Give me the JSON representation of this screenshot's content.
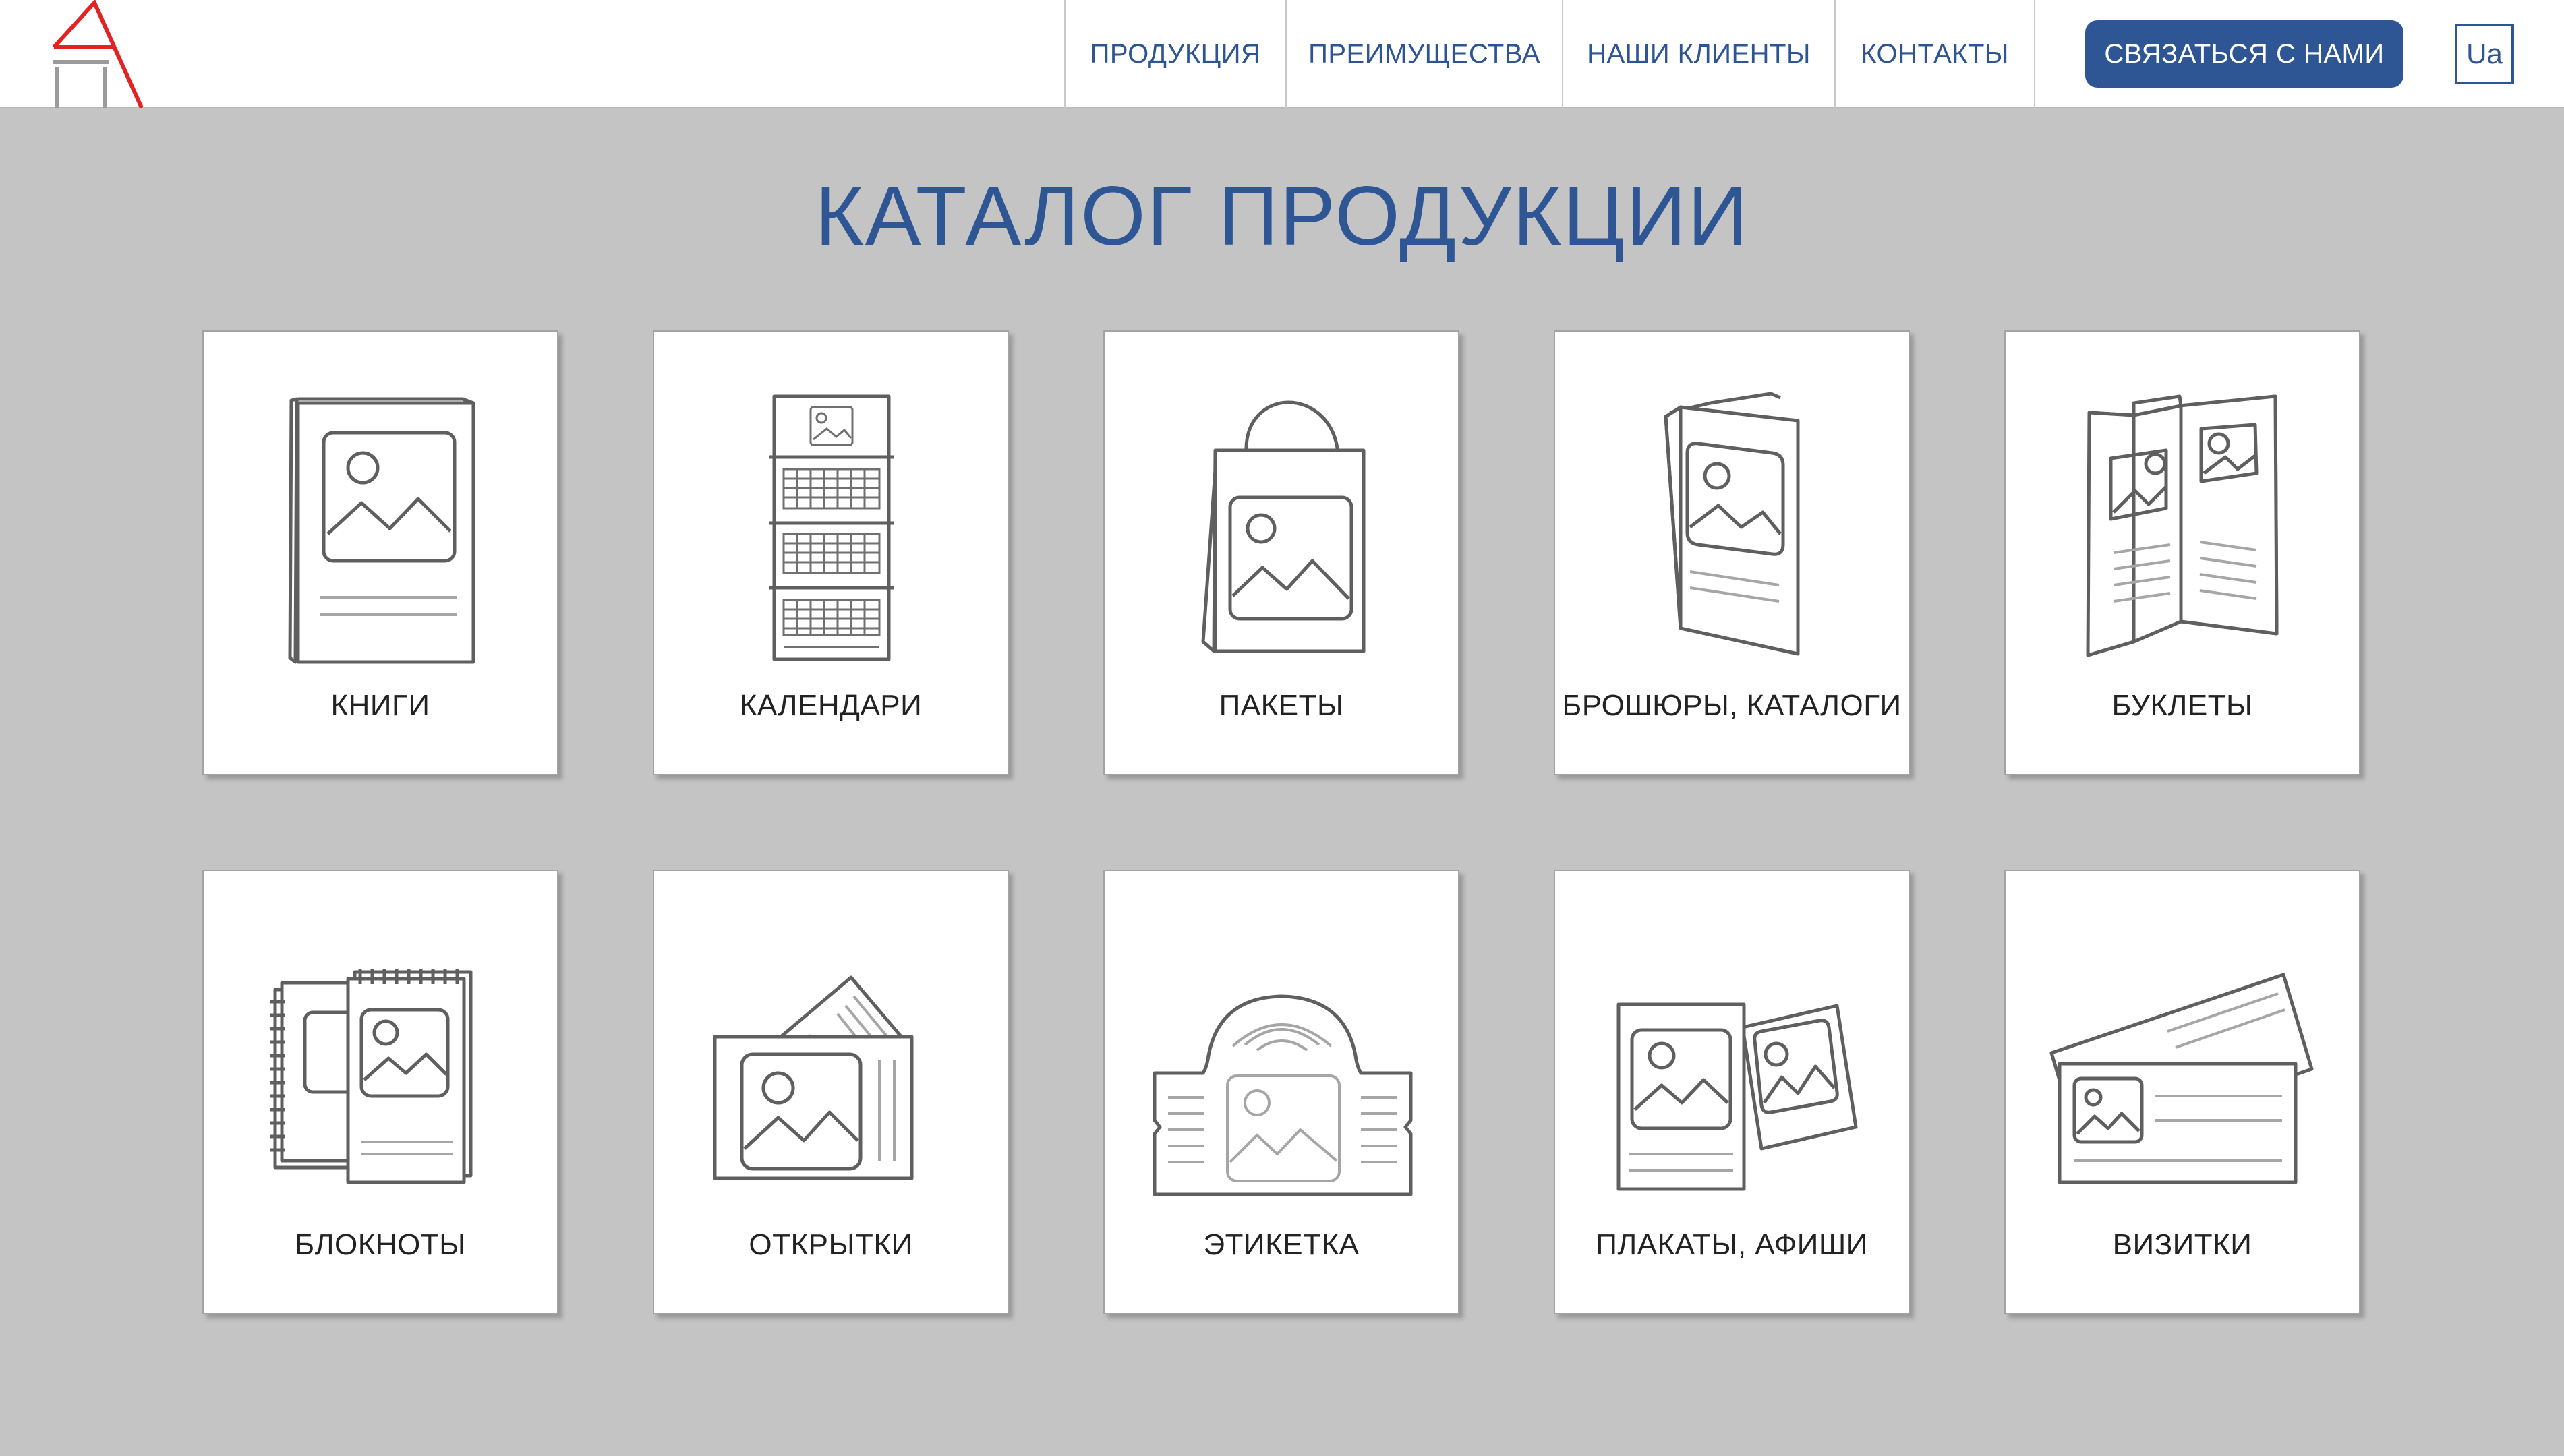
{
  "header": {
    "nav": [
      {
        "label": "ПРОДУКЦИЯ"
      },
      {
        "label": "ПРЕИМУЩЕСТВА"
      },
      {
        "label": "НАШИ КЛИЕНТЫ"
      },
      {
        "label": "КОНТАКТЫ"
      }
    ],
    "cta_label": "СВЯЗАТЬСЯ С НАМИ",
    "lang_label": "Ua"
  },
  "main": {
    "title": "КАТАЛОГ ПРОДУКЦИИ",
    "products": [
      {
        "label": "КНИГИ",
        "icon": "book-icon"
      },
      {
        "label": "КАЛЕНДАРИ",
        "icon": "calendar-icon"
      },
      {
        "label": "ПАКЕТЫ",
        "icon": "shopping-bag-icon"
      },
      {
        "label": "БРОШЮРЫ, КАТАЛОГИ",
        "icon": "brochure-icon"
      },
      {
        "label": "БУКЛЕТЫ",
        "icon": "booklet-icon"
      },
      {
        "label": "БЛОКНОТЫ",
        "icon": "notepad-icon"
      },
      {
        "label": "ОТКРЫТКИ",
        "icon": "postcard-icon"
      },
      {
        "label": "ЭТИКЕТКА",
        "icon": "label-icon"
      },
      {
        "label": "ПЛАКАТЫ, АФИШИ",
        "icon": "poster-icon"
      },
      {
        "label": "ВИЗИТКИ",
        "icon": "business-card-icon"
      }
    ]
  },
  "colors": {
    "brand_blue": "#2e5594",
    "page_background": "#c4c4c4",
    "logo_red": "#e32222"
  }
}
